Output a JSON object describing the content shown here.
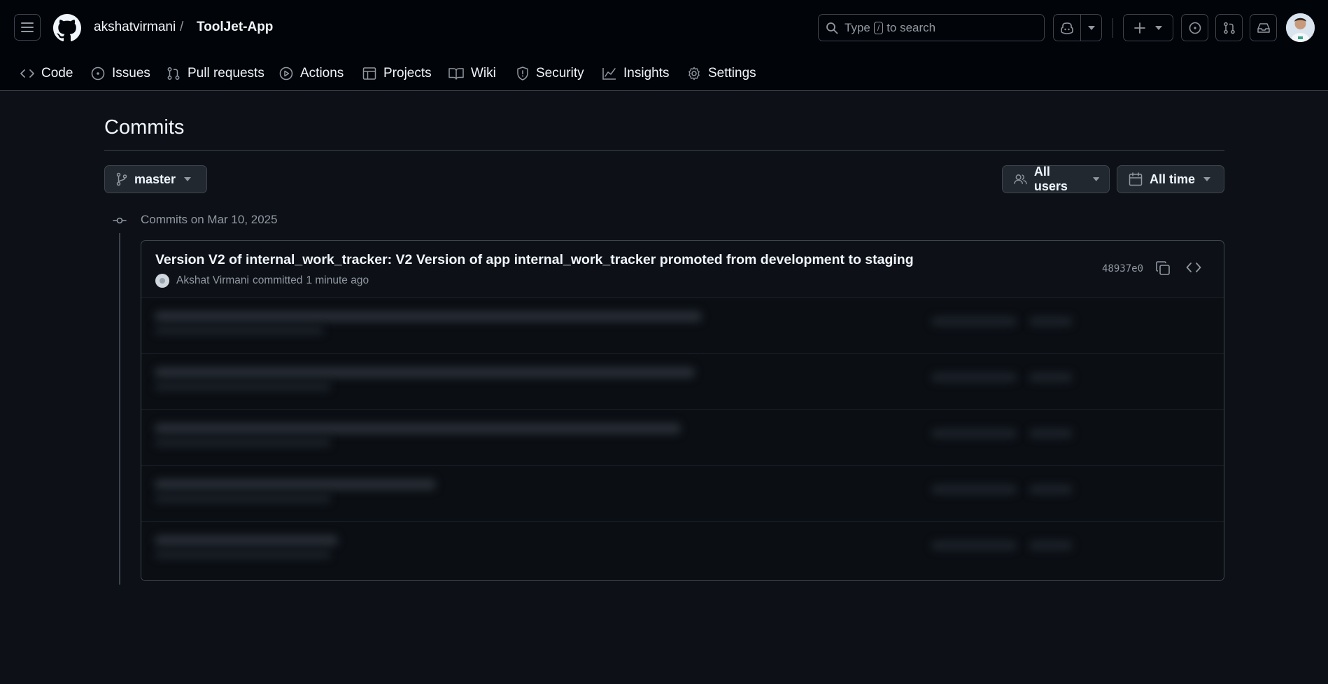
{
  "header": {
    "owner": "akshatvirmani",
    "separator": "/",
    "repo": "ToolJet-App",
    "search": {
      "prefix": "Type",
      "key": "/",
      "suffix": "to search"
    },
    "icons": [
      "hamburger-icon",
      "github-logo",
      "search-icon",
      "copilot-icon",
      "chevron-down-icon",
      "plus-icon",
      "issue-icon",
      "pull-request-icon",
      "inbox-icon"
    ]
  },
  "nav": {
    "items": [
      {
        "label": "Code",
        "icon": "code-icon"
      },
      {
        "label": "Issues",
        "icon": "issue-opened-icon"
      },
      {
        "label": "Pull requests",
        "icon": "git-pull-request-icon"
      },
      {
        "label": "Actions",
        "icon": "play-icon"
      },
      {
        "label": "Projects",
        "icon": "table-icon"
      },
      {
        "label": "Wiki",
        "icon": "book-icon"
      },
      {
        "label": "Security",
        "icon": "shield-icon"
      },
      {
        "label": "Insights",
        "icon": "graph-icon"
      },
      {
        "label": "Settings",
        "icon": "gear-icon"
      }
    ]
  },
  "main": {
    "title": "Commits",
    "branch": "master",
    "users_filter": "All users",
    "time_filter": "All time",
    "day_label": "Commits on Mar 10, 2025",
    "commits": [
      {
        "message": "Version V2 of internal_work_tracker: V2 Version of app internal_work_tracker promoted from development to staging",
        "author": "Akshat Virmani",
        "action": "committed",
        "time": "1 minute ago",
        "sha": "48937e0"
      }
    ]
  },
  "colors": {
    "bg": "#0d1117",
    "header_bg": "#010409",
    "border": "#3d444d",
    "muted": "#9198a1",
    "fg": "#f0f6fc"
  }
}
